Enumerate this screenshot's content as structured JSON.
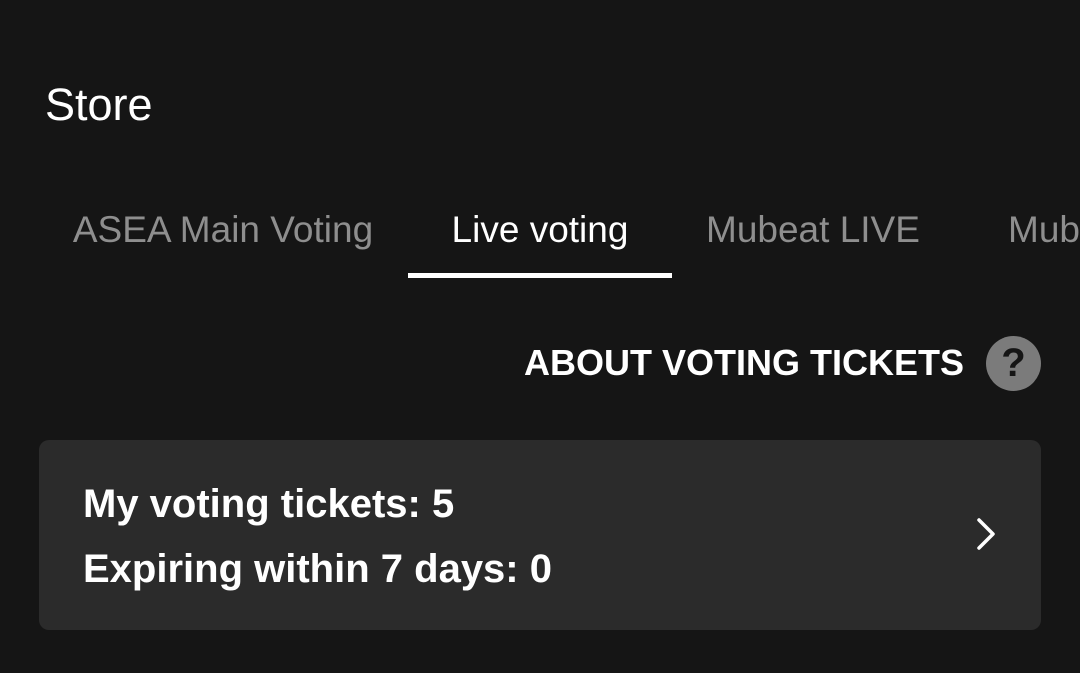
{
  "header": {
    "title": "Store"
  },
  "tabs": [
    {
      "label": "ASEA Main Voting",
      "active": false
    },
    {
      "label": "Live voting",
      "active": true
    },
    {
      "label": "Mubeat LIVE",
      "active": false
    },
    {
      "label": "Mub",
      "active": false
    }
  ],
  "help": {
    "label": "ABOUT VOTING TICKETS",
    "icon": "question-icon",
    "glyph": "?"
  },
  "tickets": {
    "summary": "My voting tickets: 5",
    "expiring": "Expiring within 7 days: 0",
    "icon": "chevron-right-icon"
  },
  "colors": {
    "background": "#151515",
    "card": "#2b2b2b",
    "active_tab": "#ffffff",
    "inactive_tab": "#8e8e8e",
    "help_icon_bg": "#7b7b7b"
  }
}
